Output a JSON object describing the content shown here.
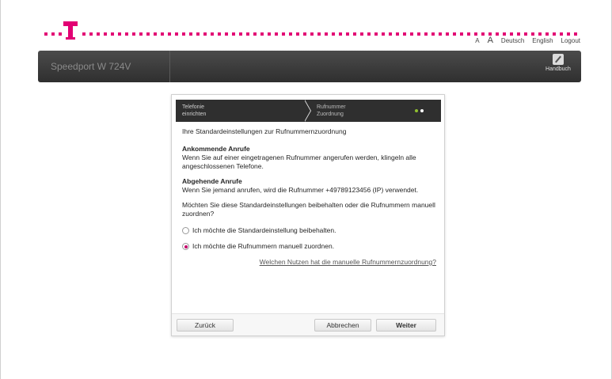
{
  "brand": {
    "logo": "telekom-t-logo",
    "accent": "#e20074"
  },
  "toplinks": {
    "font_small": "A",
    "font_large": "A",
    "lang_de": "Deutsch",
    "lang_en": "English",
    "logout": "Logout"
  },
  "header": {
    "device": "Speedport W 724V",
    "handbuch": "Handbuch",
    "handbuch_icon": "wrench-icon"
  },
  "wizard": {
    "step1_line1": "Telefonie",
    "step1_line2": "einrichten",
    "step2_line1": "Rufnummer",
    "step2_line2": "Zuordnung",
    "dot_colors": [
      "#8fbf2f",
      "#ffffff"
    ]
  },
  "content": {
    "subtitle": "Ihre Standardeinstellungen zur Rufnummernzuordnung",
    "incoming_title": "Ankommende Anrufe",
    "incoming_text": "Wenn Sie auf einer eingetragenen Rufnummer angerufen werden, klingeln alle angeschlossenen Telefone.",
    "outgoing_title": "Abgehende Anrufe",
    "outgoing_text": "Wenn Sie jemand anrufen, wird die Rufnummer +49789123456 (IP) verwendet.",
    "question": "Möchten Sie diese Standardeinstellungen beibehalten oder die Rufnummern manuell zuordnen?",
    "option_keep": "Ich möchte die Standardeinstellung beibehalten.",
    "option_manual": "Ich möchte die Rufnummern manuell zuordnen.",
    "selected_option": "manual",
    "help_link": "Welchen Nutzen hat die manuelle Rufnummernzuordnung?"
  },
  "footer": {
    "back": "Zurück",
    "cancel": "Abbrechen",
    "next": "Weiter"
  }
}
